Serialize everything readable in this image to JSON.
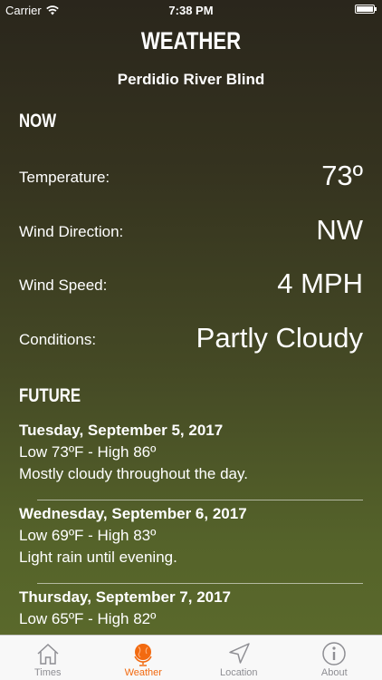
{
  "status_bar": {
    "carrier": "Carrier",
    "time": "7:38 PM"
  },
  "header": {
    "title": "WEATHER",
    "location": "Perdidio River Blind"
  },
  "now": {
    "heading": "NOW",
    "rows": [
      {
        "label": "Temperature:",
        "value": "73º"
      },
      {
        "label": "Wind Direction:",
        "value": "NW"
      },
      {
        "label": "Wind Speed:",
        "value": "4 MPH"
      },
      {
        "label": "Conditions:",
        "value": "Partly Cloudy"
      }
    ]
  },
  "future": {
    "heading": "FUTURE",
    "days": [
      {
        "day": "Tuesday, September 5, 2017",
        "temps": "Low 73ºF - High 86º",
        "summary": "Mostly cloudy throughout the day."
      },
      {
        "day": "Wednesday, September 6, 2017",
        "temps": "Low 69ºF - High 83º",
        "summary": "Light rain until evening."
      },
      {
        "day": "Thursday, September 7, 2017",
        "temps": "Low 65ºF - High 82º",
        "summary": ""
      }
    ]
  },
  "tabs": [
    {
      "label": "Times",
      "icon": "home-icon",
      "active": false
    },
    {
      "label": "Weather",
      "icon": "globe-icon",
      "active": true
    },
    {
      "label": "Location",
      "icon": "location-arrow-icon",
      "active": false
    },
    {
      "label": "About",
      "icon": "info-icon",
      "active": false
    }
  ],
  "colors": {
    "accent": "#f26a10",
    "tab_inactive": "#8e8e93",
    "tab_bar_bg": "#f8f8f8"
  }
}
